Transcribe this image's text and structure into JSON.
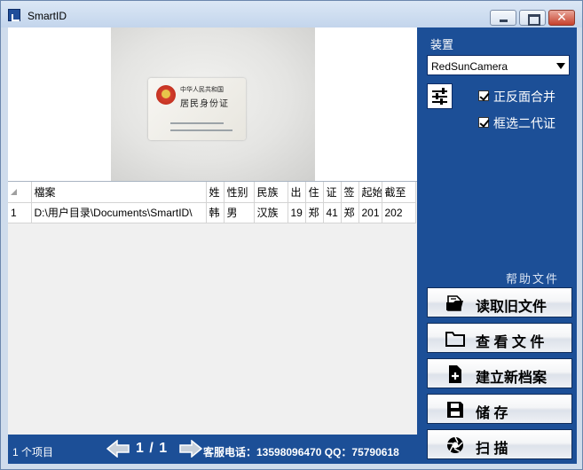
{
  "window": {
    "title": "SmartID"
  },
  "preview": {
    "card_line1": "中华人民共和国",
    "card_line2": "居民身份证"
  },
  "table": {
    "columns": [
      "",
      "檔案",
      "姓",
      "性别",
      "民族",
      "出",
      "住",
      "证",
      "签",
      "起始",
      "截至"
    ],
    "rows": [
      [
        "1",
        "D:\\用户目录\\Documents\\SmartID\\",
        "韩",
        "男",
        "汉族",
        "19",
        "郑",
        "41",
        "郑",
        "201",
        "202"
      ]
    ]
  },
  "status": {
    "count": "1 个项目",
    "page": "1 / 1",
    "service": "客服电话：13598096470  QQ：75790618"
  },
  "panel": {
    "device_label": "装置",
    "device_value": "RedSunCamera",
    "checkbox1": "正反面合并",
    "checkbox2": "框选二代证",
    "help": "帮助文件",
    "btn_read": "读取旧文件",
    "btn_view": "查 看 文 件",
    "btn_new": "建立新档案",
    "btn_save": "储          存",
    "btn_scan": "扫          描"
  },
  "icons": [
    "app-icon",
    "minimize-icon",
    "maximize-icon",
    "close-icon",
    "arrow-left-icon",
    "arrow-right-icon",
    "settings-sliders-icon",
    "checkbox-checked-icon",
    "open-file-icon",
    "folder-icon",
    "new-document-icon",
    "save-disk-icon",
    "camera-aperture-icon"
  ]
}
